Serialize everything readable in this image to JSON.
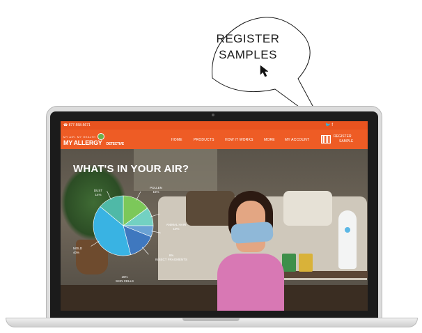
{
  "callout": {
    "line1": "REGISTER",
    "line2": "SAMPLES"
  },
  "site": {
    "phone": "☎ 877-558-5671",
    "social": "🐦 f",
    "logo_small": "MY AIR. MY HEALTH",
    "logo_main": "MY ALLERGY",
    "logo_detective": "DETECTIVE",
    "nav": [
      "HOME",
      "PRODUCTS",
      "HOW IT WORKS",
      "MORE",
      "MY ACCOUNT"
    ],
    "register": {
      "line1": "REGISTER",
      "line2": "SAMPLE"
    },
    "hero_title": "WHAT'S IN YOUR AIR?"
  },
  "chart_data": {
    "type": "pie",
    "title": "",
    "slices": [
      {
        "label": "POLLEN",
        "percent": "15%",
        "value": 15,
        "color": "#7cc85a"
      },
      {
        "label": "ANIMAL HAIR",
        "percent": "10%",
        "value": 10,
        "color": "#73d1c2"
      },
      {
        "label": "INSECT FRAGMENTS",
        "percent": "6%",
        "value": 6,
        "color": "#6aa2d4"
      },
      {
        "label": "SKIN CELLS",
        "percent": "15%",
        "value": 15,
        "color": "#3f78bf"
      },
      {
        "label": "MOLD",
        "percent": "40%",
        "value": 40,
        "color": "#39b3e3"
      },
      {
        "label": "DUST",
        "percent": "14%",
        "value": 14,
        "color": "#4fb9a7"
      }
    ]
  },
  "colors": {
    "brand": "#ee5c25",
    "brand_dark": "#e8531f"
  }
}
